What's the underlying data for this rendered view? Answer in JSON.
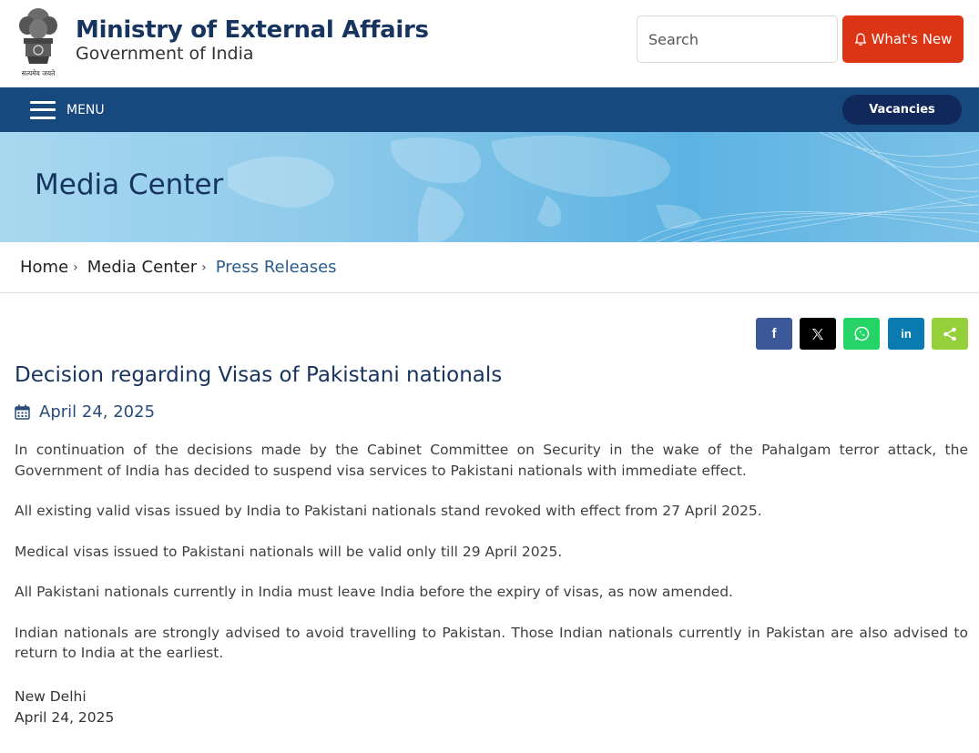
{
  "header": {
    "title": "Ministry of External Affairs",
    "subtitle": "Government of India",
    "emblem_caption": "सत्यमेव जयते",
    "search_placeholder": "Search",
    "whats_new_label": "What's New"
  },
  "nav": {
    "menu_label": "MENU",
    "vacancies_label": "Vacancies"
  },
  "banner": {
    "title": "Media Center"
  },
  "breadcrumb": {
    "items": [
      "Home",
      "Media Center",
      "Press Releases"
    ],
    "separator": "›"
  },
  "share": {
    "buttons": [
      {
        "name": "facebook",
        "glyph": "f",
        "color": "#3b5998"
      },
      {
        "name": "x-twitter",
        "glyph": "𝕏",
        "color": "#000000"
      },
      {
        "name": "whatsapp",
        "glyph": "w",
        "color": "#25d366"
      },
      {
        "name": "linkedin",
        "glyph": "in",
        "color": "#0a7bb1"
      },
      {
        "name": "share",
        "glyph": "share",
        "color": "#95d03a"
      }
    ]
  },
  "article": {
    "title": "Decision regarding Visas of Pakistani nationals",
    "date": "April 24, 2025",
    "paragraphs": [
      "In continuation of the decisions made by the Cabinet Committee on Security in the wake of the Pahalgam terror attack, the Government of India has decided to suspend visa services to Pakistani nationals with immediate effect.",
      "All existing valid visas issued by India to Pakistani nationals stand revoked with effect from 27 April 2025.",
      "Medical visas issued to Pakistani nationals will be valid only till 29 April 2025.",
      "All Pakistani nationals currently in India must leave India before the expiry of visas, as now amended.",
      "Indian nationals are strongly advised to avoid travelling to Pakistan. Those Indian nationals currently in Pakistan are also advised to return to India at the earliest."
    ],
    "place": "New Delhi",
    "sign_date": "April 24, 2025"
  },
  "colors": {
    "brand_navy": "#17345f",
    "nav_blue": "#17497f",
    "alert_red": "#dc3516"
  }
}
